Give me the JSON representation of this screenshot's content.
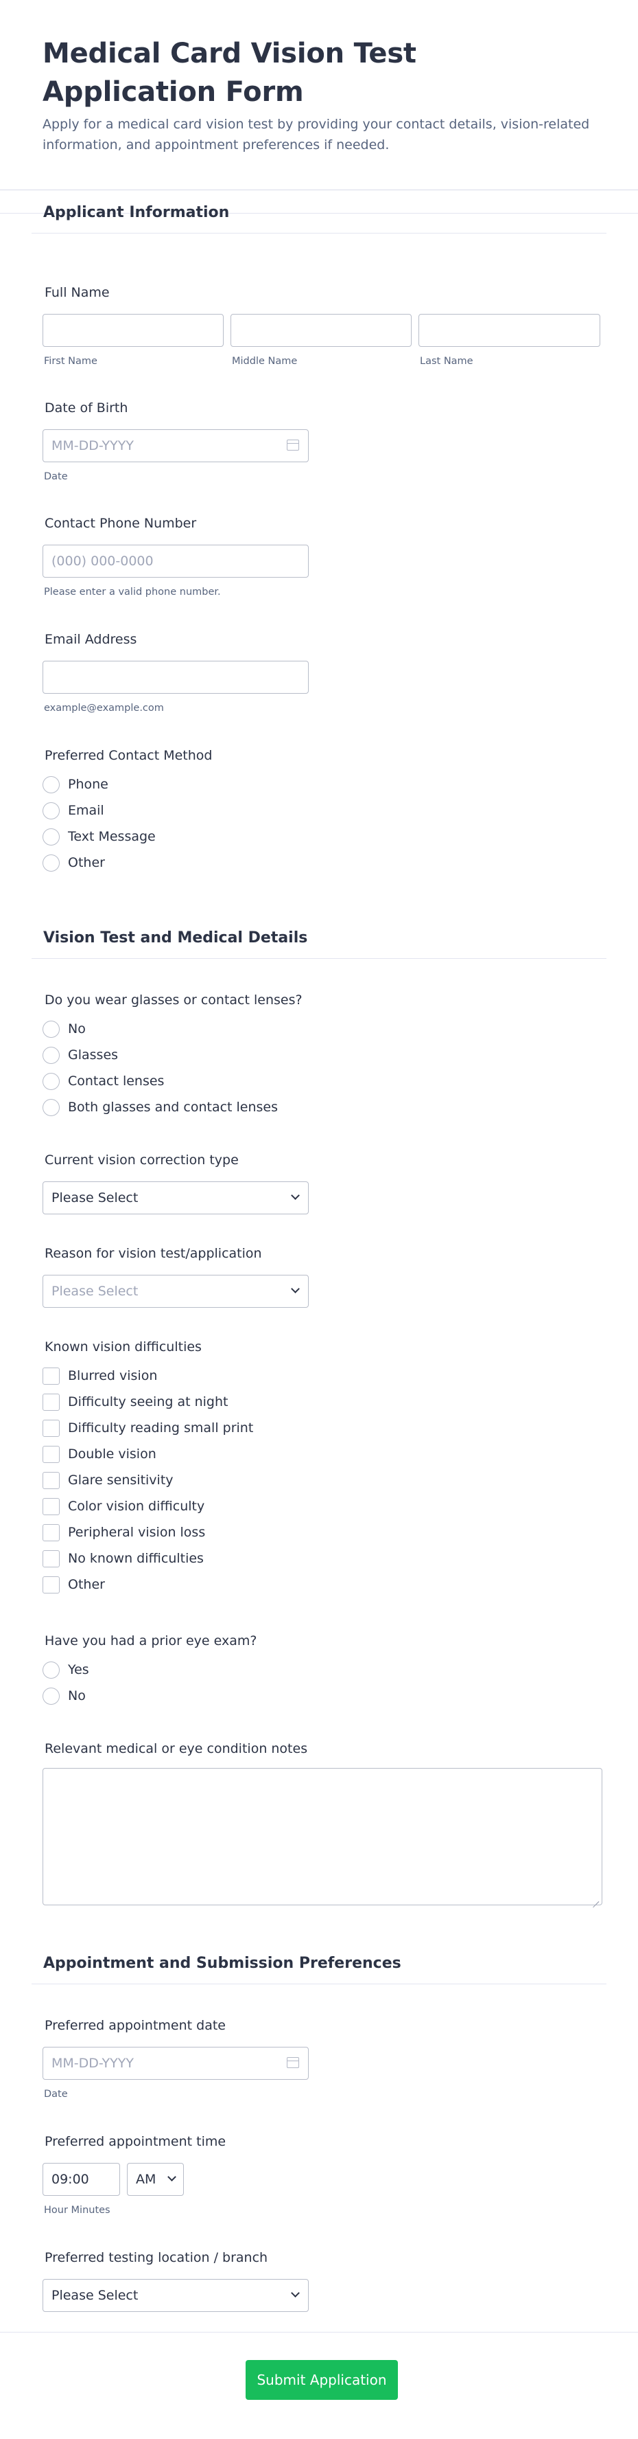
{
  "form": {
    "title": "Medical Card Vision Test Application Form",
    "description": "Apply for a medical card vision test by providing your contact details, vision-related information, and appointment preferences if needed."
  },
  "sections": {
    "applicant": "Applicant Information",
    "vision": "Vision Test and Medical Details",
    "appointment": "Appointment and Submission Preferences"
  },
  "full_name": {
    "label": "Full Name",
    "first": "First Name",
    "middle": "Middle Name",
    "last": "Last Name"
  },
  "dob": {
    "label": "Date of Birth",
    "placeholder": "MM-DD-YYYY",
    "sublabel": "Date",
    "icon": "calendar-icon"
  },
  "phone": {
    "label": "Contact Phone Number",
    "placeholder": "(000) 000-0000",
    "sublabel": "Please enter a valid phone number."
  },
  "email": {
    "label": "Email Address",
    "sublabel": "example@example.com"
  },
  "contact_method": {
    "label": "Preferred Contact Method",
    "options": [
      "Phone",
      "Email",
      "Text Message",
      "Other"
    ]
  },
  "glasses": {
    "label": "Do you wear glasses or contact lenses?",
    "options": [
      "No",
      "Glasses",
      "Contact lenses",
      "Both glasses and contact lenses"
    ]
  },
  "correction_type": {
    "label": "Current vision correction type",
    "value": "Please Select"
  },
  "reason": {
    "label": "Reason for vision test/application",
    "placeholder": "Please Select"
  },
  "difficulties": {
    "label": "Known vision difficulties",
    "options": [
      "Blurred vision",
      "Difficulty seeing at night",
      "Difficulty reading small print",
      "Double vision",
      "Glare sensitivity",
      "Color vision difficulty",
      "Peripheral vision loss",
      "No known difficulties",
      "Other"
    ]
  },
  "prior_exam": {
    "label": "Have you had a prior eye exam?",
    "options": [
      "Yes",
      "No"
    ]
  },
  "notes": {
    "label": "Relevant medical or eye condition notes"
  },
  "appt_date": {
    "label": "Preferred appointment date",
    "placeholder": "MM-DD-YYYY",
    "sublabel": "Date"
  },
  "appt_time": {
    "label": "Preferred appointment time",
    "time": "09:00",
    "ampm": "AM",
    "sublabel": "Hour Minutes"
  },
  "location": {
    "label": "Preferred testing location / branch",
    "value": "Please Select"
  },
  "submit_label": "Submit Application",
  "colors": {
    "accent": "#18bd5b",
    "text": "#2c3345",
    "muted": "#57647e",
    "border": "#b8bdc9"
  }
}
